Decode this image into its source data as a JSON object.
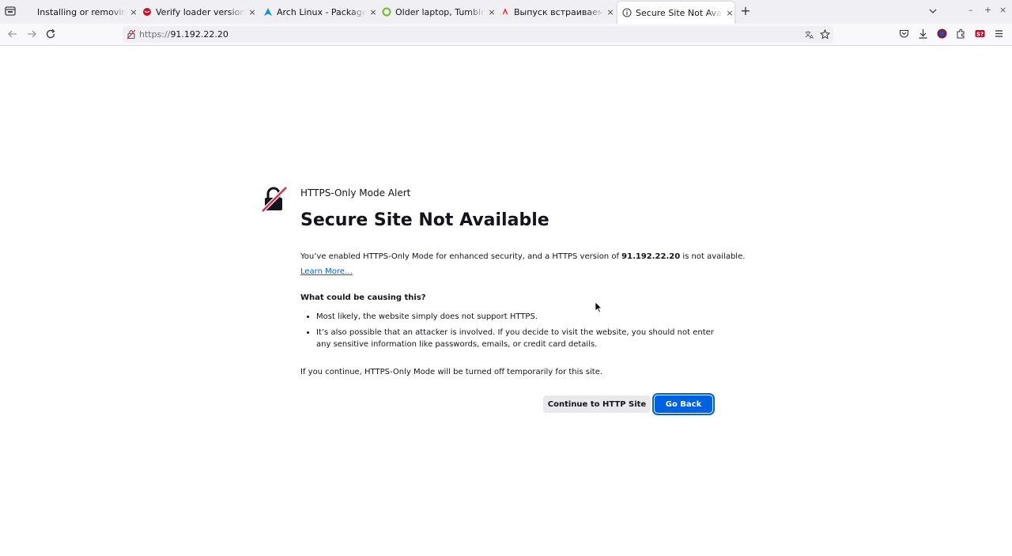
{
  "tabs": [
    {
      "title": "Installing or removing softw",
      "favicon": "doc-icon"
    },
    {
      "title": "Verify loader version? | ",
      "favicon": "red-glass-icon"
    },
    {
      "title": "Arch Linux - Package Sea",
      "favicon": "arch-icon"
    },
    {
      "title": "Older laptop, Tumblewe",
      "favicon": "opensuse-icon"
    },
    {
      "title": "Выпуск встраиваемой С",
      "favicon": "opennet-icon"
    },
    {
      "title": "Secure Site Not Available",
      "favicon": "info-icon",
      "active": true
    }
  ],
  "close_glyph": "×",
  "newtab_glyph": "+",
  "window_controls": {
    "minimize": "–",
    "maximize": "+",
    "close": "×"
  },
  "address": {
    "scheme": "https://",
    "host": "91.192.22.20"
  },
  "page": {
    "alert_label": "HTTPS-Only Mode Alert",
    "title": "Secure Site Not Available",
    "intro_before": "You’ve enabled HTTPS-Only Mode for enhanced security, and a HTTPS version of ",
    "intro_host": "91.192.22.20",
    "intro_after": " is not available.",
    "learn_more": "Learn More…",
    "causes_heading": "What could be causing this?",
    "causes": [
      "Most likely, the website simply does not support HTTPS.",
      "It’s also possible that an attacker is involved. If you decide to visit the website, you should not enter any sensitive information like passwords, emails, or credit card details."
    ],
    "continue_note": "If you continue, HTTPS-Only Mode will be turned off temporarily for this site.",
    "continue_button": "Continue to HTTP Site",
    "back_button": "Go Back"
  },
  "colors": {
    "accent": "#0061e0",
    "alert_red": "#e22850"
  }
}
